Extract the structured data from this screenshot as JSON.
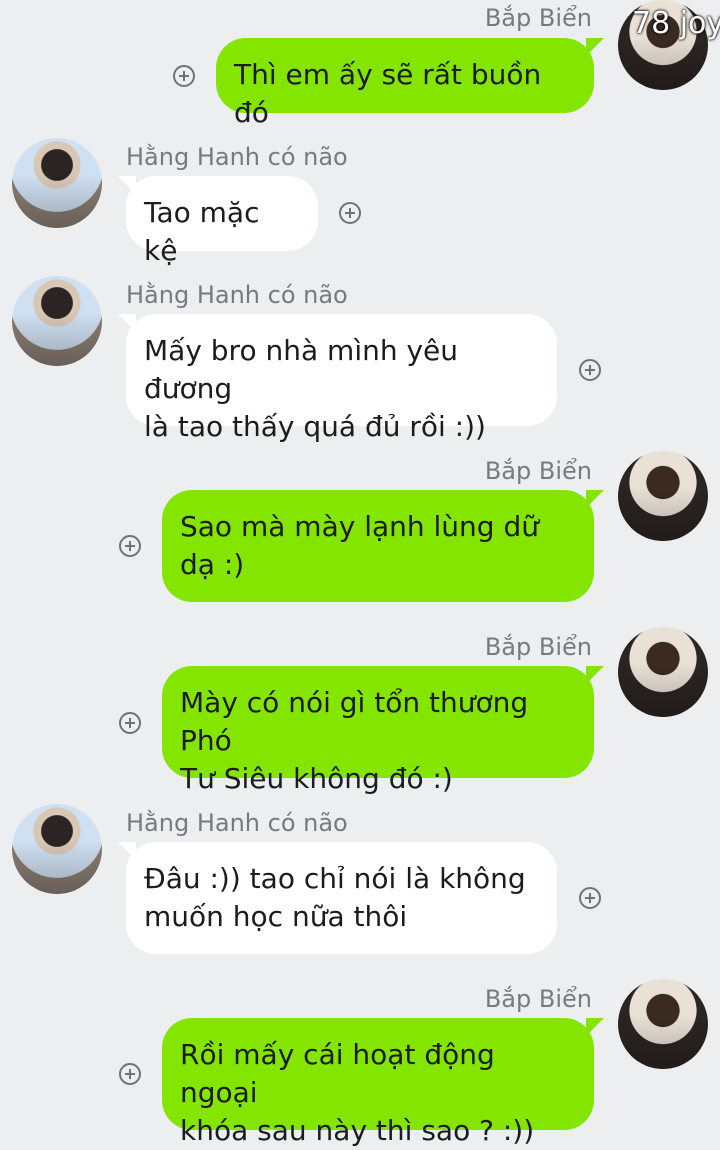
{
  "watermark": "78 joy",
  "messages": [
    {
      "sender": "Bắp Biển",
      "side": "right",
      "text": "Thì em ấy sẽ rất buồn đó"
    },
    {
      "sender": "Hằng Hanh có não",
      "side": "left",
      "text": "Tao mặc kệ"
    },
    {
      "sender": "Hằng Hanh có não",
      "side": "left",
      "text": "Mấy bro nhà mình yêu đương\nlà tao thấy quá đủ rồi :))"
    },
    {
      "sender": "Bắp Biển",
      "side": "right",
      "text": "Sao mà mày lạnh lùng dữ\ndạ :)"
    },
    {
      "sender": "Bắp Biển",
      "side": "right",
      "text": "Mày có nói gì tổn thương Phó\nTư Siêu không đó :)"
    },
    {
      "sender": "Hằng Hanh có não",
      "side": "left",
      "text": "Đâu :)) tao chỉ nói là không\nmuốn học nữa thôi"
    },
    {
      "sender": "Bắp Biển",
      "side": "right",
      "text": "Rồi mấy cái hoạt động ngoại\nkhóa sau này thì sao ? :))"
    }
  ],
  "colors": {
    "sent_bubble": "#84e500",
    "received_bubble": "#ffffff",
    "background": "#edeef0"
  },
  "icons": {
    "add": "plus-circle-icon"
  }
}
